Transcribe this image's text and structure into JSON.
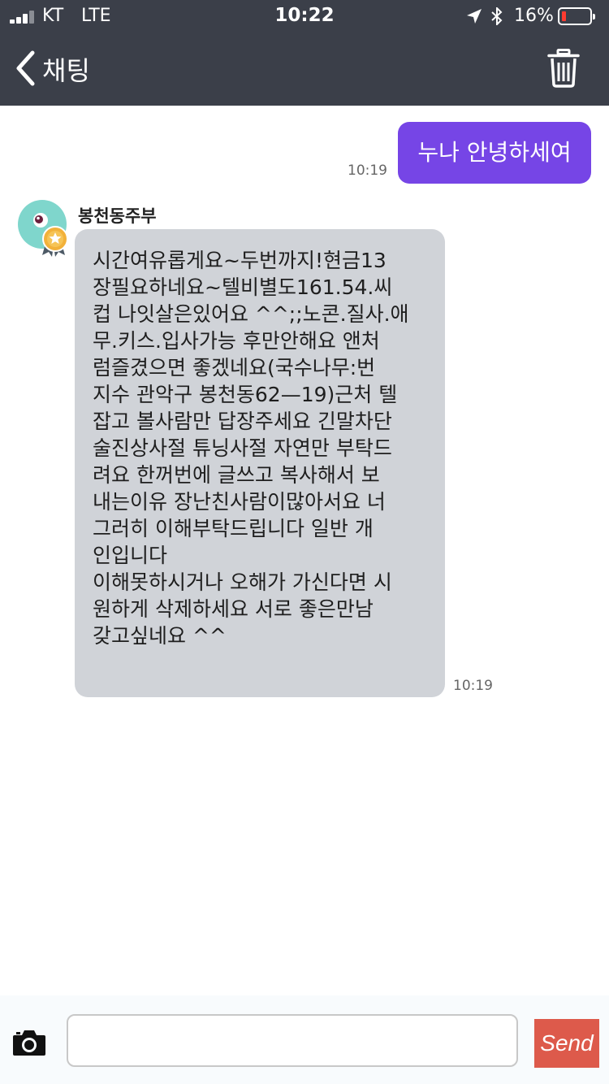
{
  "status_bar": {
    "carrier": "KT",
    "network": "LTE",
    "time": "10:22",
    "battery_percent": "16%",
    "battery_level": 0.16,
    "battery_color": "#ff3b30"
  },
  "nav": {
    "back_label": "채팅",
    "icons": [
      "chevron-left-icon",
      "trash-icon"
    ]
  },
  "messages": {
    "outgoing": {
      "text": "누나 안녕하세여",
      "time": "10:19",
      "color": "#7645e6"
    },
    "incoming": {
      "sender": "봉천동주부",
      "time": "10:19",
      "color": "#d0d3d8",
      "lines": [
        "시간여유롭게요~두번까지!현금13",
        "장필요하네요~텔비별도161.54.씨",
        "컵 나잇살은있어요 ^^;;노콘.질사.애",
        "무.키스.입사가능 후만안해요 앤처",
        "럼즐겼으면 좋겠네요(국수나무:번",
        "지수 관악구 봉천동62—19)근처 텔",
        "잡고 볼사람만 답장주세요 긴말차단",
        "술진상사절 튜닝사절 자연만 부탁드",
        "려요 한꺼번에 글쓰고 복사해서 보",
        "내는이유 장난친사람이많아서요 너",
        "그러히 이해부탁드립니다  일반 개",
        "인입니다",
        "이해못하시거나 오해가 가신다면 시",
        "원하게  삭제하세요  서로 좋은만남",
        "갖고싶네요 ^^"
      ]
    }
  },
  "input_bar": {
    "message_value": "",
    "send_label": "Send",
    "send_color": "#dd5a4b",
    "icons": [
      "camera-icon"
    ]
  }
}
